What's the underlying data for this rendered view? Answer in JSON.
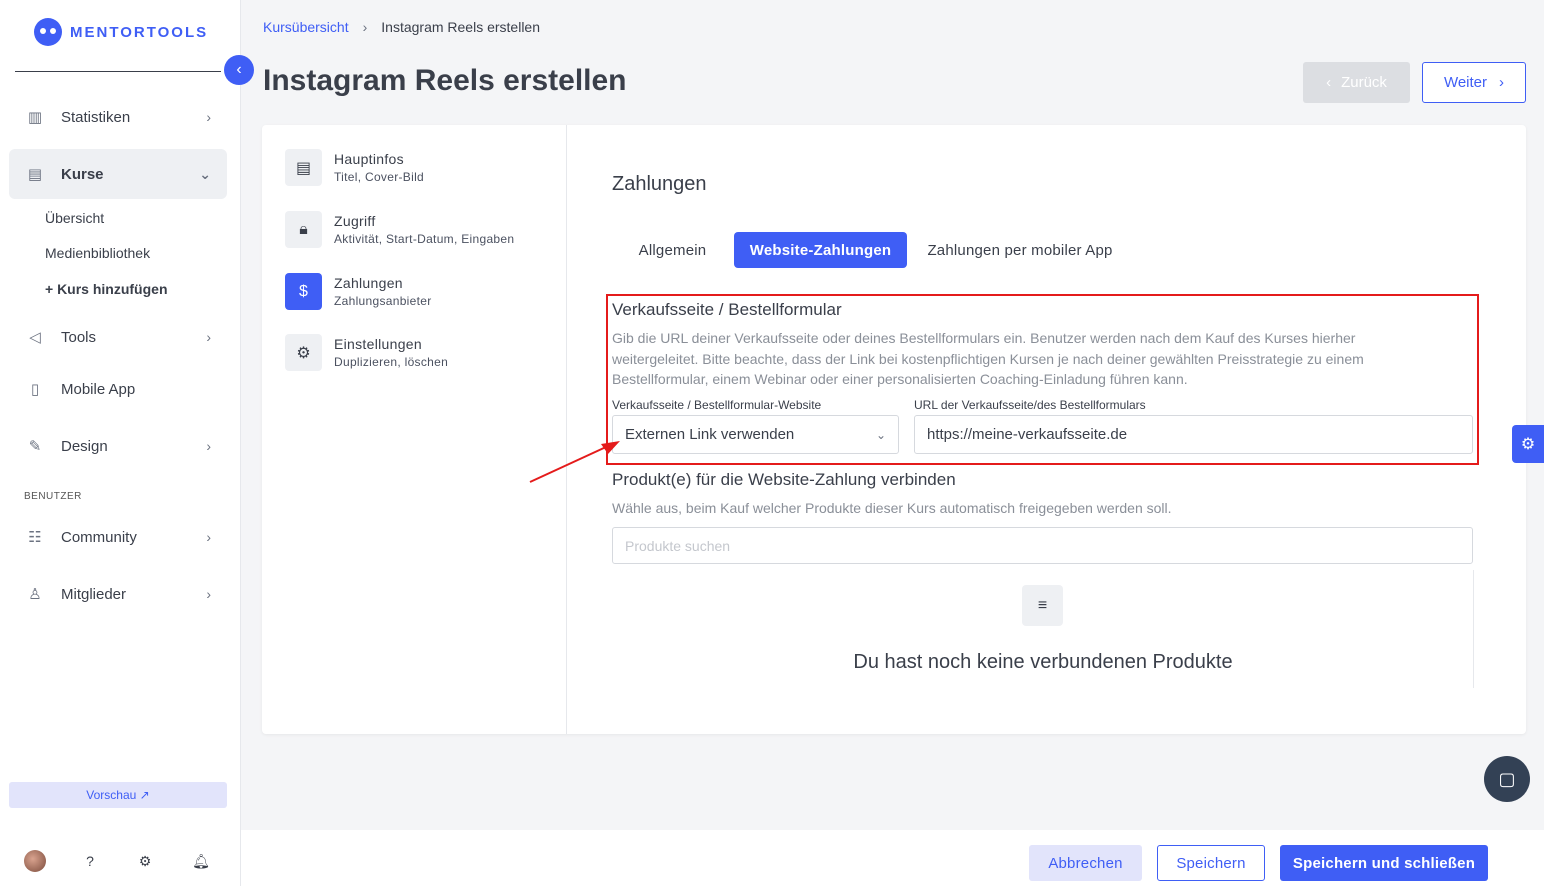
{
  "brand": {
    "name": "MENTORTOOLS",
    "accent": "#3f5ef5"
  },
  "sidebar": {
    "items": [
      {
        "label": "Statistiken",
        "icon": "bar-chart-icon"
      },
      {
        "label": "Kurse",
        "icon": "document-icon"
      },
      {
        "label": "Tools",
        "icon": "megaphone-icon"
      },
      {
        "label": "Mobile App",
        "icon": "phone-icon"
      },
      {
        "label": "Design",
        "icon": "pen-icon"
      },
      {
        "label": "Community",
        "icon": "people-icon"
      },
      {
        "label": "Mitglieder",
        "icon": "user-icon"
      }
    ],
    "sub_items": [
      "Übersicht",
      "Medienbibliothek",
      "+ Kurs hinzufügen"
    ],
    "section_label": "BENUTZER",
    "preview_label": "Vorschau ↗"
  },
  "breadcrumb": {
    "parent": "Kursübersicht",
    "current": "Instagram Reels erstellen"
  },
  "page_title": "Instagram Reels erstellen",
  "nav_buttons": {
    "back": "Zurück",
    "next": "Weiter"
  },
  "steps": [
    {
      "title": "Hauptinfos",
      "subtitle": "Titel, Cover-Bild"
    },
    {
      "title": "Zugriff",
      "subtitle": "Aktivität, Start-Datum, Eingaben"
    },
    {
      "title": "Zahlungen",
      "subtitle": "Zahlungsanbieter"
    },
    {
      "title": "Einstellungen",
      "subtitle": "Duplizieren, löschen"
    }
  ],
  "section_title": "Zahlungen",
  "tabs": [
    "Allgemein",
    "Website-Zahlungen",
    "Zahlungen per mobiler App"
  ],
  "sales_page": {
    "heading": "Verkaufsseite / Bestellformular",
    "description": "Gib die URL deiner Verkaufsseite oder deines Bestellformulars ein. Benutzer werden nach dem Kauf des Kurses hierher weitergeleitet. Bitte beachte, dass der Link bei kostenpflichtigen Kursen je nach deiner gewählten Preisstrategie zu einem Bestellformular, einem Webinar oder einer personalisierten Coaching-Einladung führen kann.",
    "select_label": "Verkaufsseite / Bestellformular-Website",
    "select_value": "Externen Link verwenden",
    "url_label": "URL der Verkaufsseite/des Bestellformulars",
    "url_value": "https://meine-verkaufsseite.de"
  },
  "products": {
    "heading": "Produkt(e) für die Website-Zahlung verbinden",
    "description": "Wähle aus, beim Kauf welcher Produkte dieser Kurs automatisch freigegeben werden soll.",
    "search_placeholder": "Produkte suchen",
    "empty_text": "Du hast noch keine verbundenen Produkte"
  },
  "footer": {
    "cancel": "Abbrechen",
    "save": "Speichern",
    "save_close": "Speichern und schließen"
  }
}
